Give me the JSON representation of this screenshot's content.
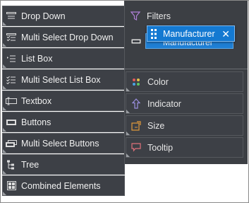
{
  "elements": [
    {
      "label": "Drop Down",
      "icon": "dropdown-icon"
    },
    {
      "label": "Multi Select Drop Down",
      "icon": "multi-select-dropdown-icon"
    },
    {
      "label": "List Box",
      "icon": "listbox-icon"
    },
    {
      "label": "Multi Select List Box",
      "icon": "multi-select-listbox-icon"
    },
    {
      "label": "Textbox",
      "icon": "textbox-icon"
    },
    {
      "label": "Buttons",
      "icon": "buttons-icon"
    },
    {
      "label": "Multi Select Buttons",
      "icon": "multi-select-buttons-icon"
    },
    {
      "label": "Tree",
      "icon": "tree-icon"
    },
    {
      "label": "Combined Elements",
      "icon": "combined-elements-icon"
    }
  ],
  "filters": {
    "label": "Filters",
    "icon": "funnel-icon",
    "field_behind": "Manufacturer",
    "dragged_chip": {
      "label": "Manufacturer",
      "close": "✕"
    }
  },
  "zones": [
    {
      "label": "Color",
      "icon": "palette-icon"
    },
    {
      "label": "Indicator",
      "icon": "indicator-icon"
    },
    {
      "label": "Size",
      "icon": "size-icon"
    },
    {
      "label": "Tooltip",
      "icon": "tooltip-icon"
    }
  ],
  "colors": {
    "panel": "#3d4046",
    "chip": "#1479d1",
    "filter_icon": "#b07fd6",
    "size_icon": "#e39a3b",
    "tooltip_icon": "#e0707a",
    "indicator_icon": "#9b8fe0"
  }
}
